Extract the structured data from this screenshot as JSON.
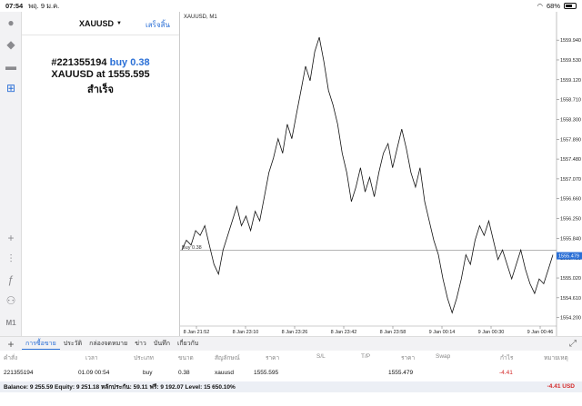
{
  "status": {
    "time": "07:54",
    "date": "พฤ. 9 ม.ค.",
    "wifi": "wifi-icon",
    "battery": "68%",
    "battery_level": 0.68
  },
  "panel": {
    "symbol": "XAUUSD",
    "done": "เสร็จสิ้น",
    "order_number": "#221355194",
    "order_side": "buy 0.38",
    "order_price_line": "XAUUSD at 1555.595",
    "order_result": "สำเร็จ"
  },
  "chart": {
    "title": "XAUUSD, M1",
    "buy_label": "Buy 0.38",
    "current_price": "1555.479",
    "y_ticks": [
      "1559.940",
      "1559.530",
      "1559.120",
      "1558.710",
      "1558.300",
      "1557.890",
      "1557.480",
      "1557.070",
      "1556.660",
      "1556.250",
      "1555.840",
      "1555.430",
      "1555.020",
      "1554.610",
      "1554.200"
    ],
    "x_ticks": [
      "8 Jan 21:52",
      "8 Jan 23:10",
      "8 Jan 23:26",
      "8 Jan 23:42",
      "8 Jan 23:58",
      "9 Jan 00:14",
      "9 Jan 00:30",
      "9 Jan 00:46"
    ]
  },
  "chart_data": {
    "type": "line",
    "title": "XAUUSD, M1",
    "ylim": [
      1554.1,
      1560.3
    ],
    "buy_level": 1555.595,
    "series": [
      {
        "values": [
          1555.6,
          1555.8,
          1555.7,
          1556.0,
          1555.9,
          1556.1,
          1555.7,
          1555.3,
          1555.1,
          1555.6,
          1555.9,
          1556.2,
          1556.5,
          1556.1,
          1556.3,
          1556.0,
          1556.4,
          1556.2,
          1556.7,
          1557.2,
          1557.5,
          1557.9,
          1557.6,
          1558.2,
          1557.9,
          1558.4,
          1558.9,
          1559.4,
          1559.1,
          1559.7,
          1560.0,
          1559.5,
          1558.9,
          1558.6,
          1558.2,
          1557.6,
          1557.2,
          1556.6,
          1556.9,
          1557.3,
          1556.8,
          1557.1,
          1556.7,
          1557.2,
          1557.6,
          1557.8,
          1557.3,
          1557.7,
          1558.1,
          1557.7,
          1557.2,
          1556.9,
          1557.3,
          1556.6,
          1556.2,
          1555.8,
          1555.5,
          1555.0,
          1554.6,
          1554.3,
          1554.6,
          1555.0,
          1555.5,
          1555.3,
          1555.8,
          1556.1,
          1555.9,
          1556.2,
          1555.8,
          1555.4,
          1555.6,
          1555.3,
          1555.0,
          1555.3,
          1555.6,
          1555.2,
          1554.9,
          1554.7,
          1555.0,
          1554.9,
          1555.2,
          1555.5
        ]
      }
    ]
  },
  "tabs": [
    "การซื้อขาย",
    "ประวัติ",
    "กล่องจดหมาย",
    "ข่าว",
    "บันทึก",
    "เกี่ยวกับ"
  ],
  "table": {
    "headers": [
      "คำสั่ง",
      "เวลา",
      "ประเภท",
      "ขนาด",
      "สัญลักษณ์",
      "ราคา",
      "S/L",
      "T/P",
      "ราคา",
      "Swap",
      "กำไร",
      "หมายเหตุ"
    ],
    "row": [
      "221355194",
      "01.09 00:54",
      "buy",
      "0.38",
      "xauusd",
      "1555.595",
      "",
      "",
      "1555.479",
      "",
      "-4.41",
      ""
    ]
  },
  "balance": {
    "text": "Balance: 9 255.59 Equity: 9 251.18 หลักประกัน: 59.11 ฟรี: 9 192.07 Level: 15 650.10%",
    "total": "-4.41  USD"
  },
  "colors": {
    "accent": "#2a6fd6",
    "negative": "#d42a2a"
  }
}
